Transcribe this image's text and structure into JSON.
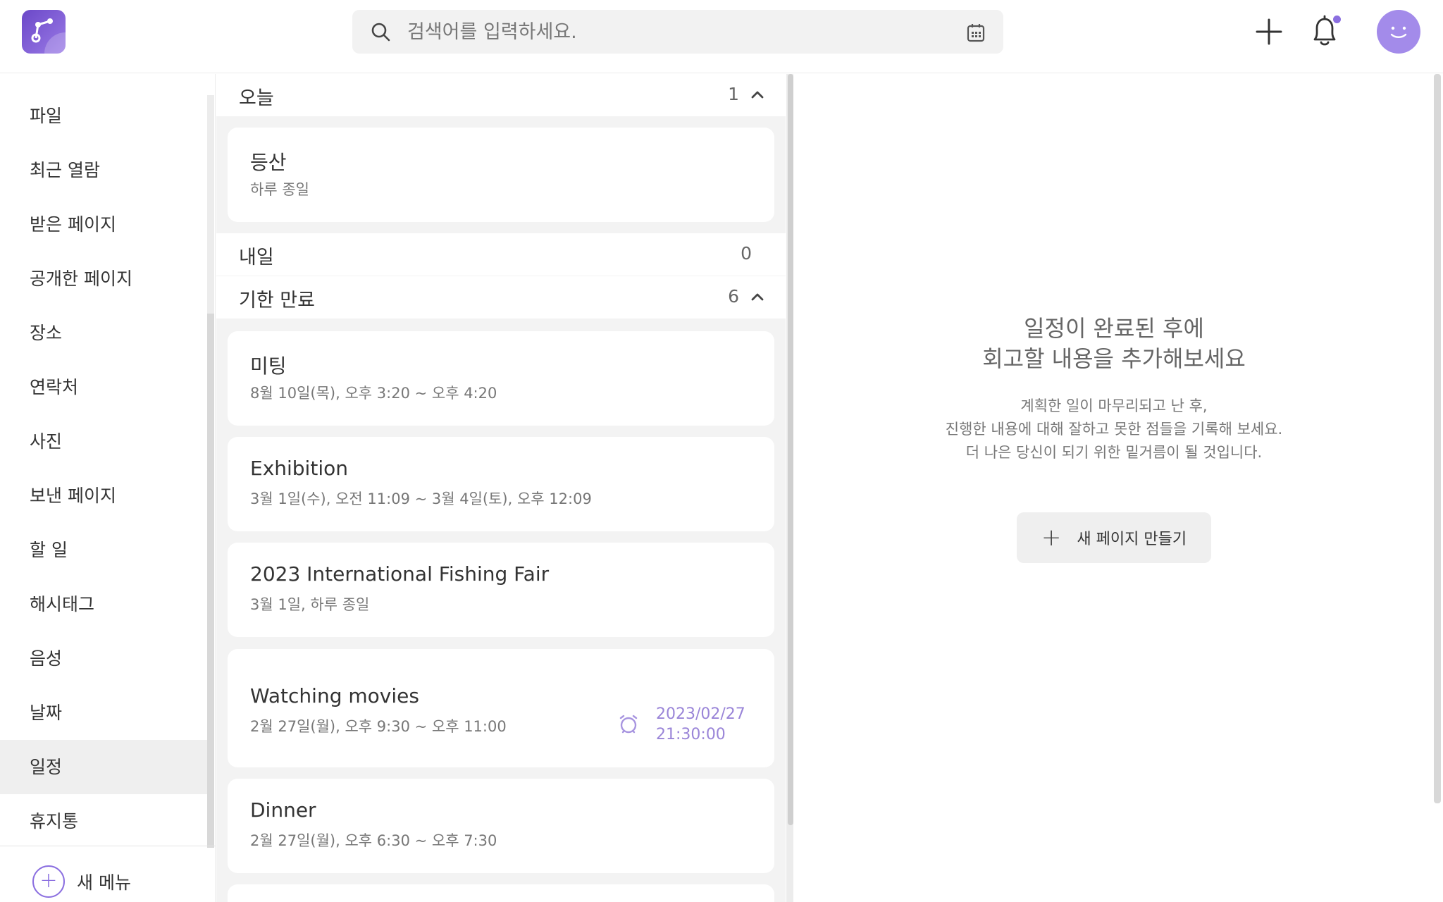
{
  "header": {
    "search_placeholder": "검색어를 입력하세요."
  },
  "sidebar": {
    "items": [
      {
        "label": "파일"
      },
      {
        "label": "최근 열람"
      },
      {
        "label": "받은 페이지"
      },
      {
        "label": "공개한 페이지"
      },
      {
        "label": "장소"
      },
      {
        "label": "연락처"
      },
      {
        "label": "사진"
      },
      {
        "label": "보낸 페이지"
      },
      {
        "label": "할 일"
      },
      {
        "label": "해시태그"
      },
      {
        "label": "음성"
      },
      {
        "label": "날짜"
      },
      {
        "label": "일정",
        "active": true
      },
      {
        "label": "휴지통"
      }
    ],
    "new_menu_label": "새 메뉴"
  },
  "list": {
    "sections": [
      {
        "title": "오늘",
        "count": "1"
      },
      {
        "title": "내일",
        "count": "0"
      },
      {
        "title": "기한 만료",
        "count": "6"
      }
    ],
    "today_cards": [
      {
        "title": "등산",
        "subtitle": "하루 종일"
      }
    ],
    "expired_cards": [
      {
        "title": "미팅",
        "subtitle": "8월 10일(목), 오후 3:20 ~ 오후 4:20"
      },
      {
        "title": "Exhibition",
        "subtitle": "3월 1일(수), 오전 11:09 ~ 3월 4일(토), 오후 12:09"
      },
      {
        "title": "2023 International Fishing Fair",
        "subtitle": "3월 1일, 하루 종일"
      },
      {
        "title": "Watching movies",
        "subtitle": "2월 27일(월), 오후 9:30 ~ 오후 11:00",
        "alarm_date": "2023/02/27",
        "alarm_time": "21:30:00"
      },
      {
        "title": "Dinner",
        "subtitle": "2월 27일(월), 오후 6:30 ~ 오후 7:30"
      }
    ]
  },
  "detail": {
    "title_line1": "일정이 완료된 후에",
    "title_line2": "회고할 내용을 추가해보세요",
    "desc_line1": "계획한 일이 마무리되고 난 후,",
    "desc_line2": "진행한 내용에 대해 잘하고 못한 점들을 기록해 보세요.",
    "desc_line3": "더 나은 당신이 되기 위한 밑거름이 될 것입니다.",
    "new_page_button": "새 페이지 만들기"
  },
  "colors": {
    "accent": "#8b6fe0",
    "avatar": "#a38bea",
    "alarm_text": "#9a85d8"
  }
}
